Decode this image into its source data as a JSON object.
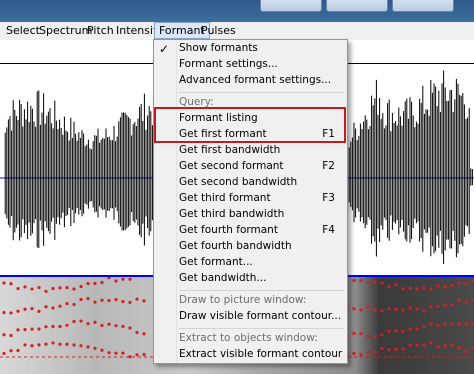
{
  "menubar": {
    "items": [
      "Select",
      "Spectrum",
      "Pitch",
      "Intensity",
      "Formant",
      "Pulses"
    ]
  },
  "formant_menu": {
    "show_formants": "Show formants",
    "formant_settings": "Formant settings...",
    "advanced_formant_settings": "Advanced formant settings...",
    "query_header": "Query:",
    "formant_listing": "Formant listing",
    "get_first_formant": "Get first formant",
    "get_first_formant_shortcut": "F1",
    "get_first_bandwidth": "Get first bandwidth",
    "get_second_formant": "Get second formant",
    "get_second_formant_shortcut": "F2",
    "get_second_bandwidth": "Get second bandwidth",
    "get_third_formant": "Get third formant",
    "get_third_formant_shortcut": "F3",
    "get_third_bandwidth": "Get third bandwidth",
    "get_fourth_formant": "Get fourth formant",
    "get_fourth_formant_shortcut": "F4",
    "get_fourth_bandwidth": "Get fourth bandwidth",
    "get_formant": "Get formant...",
    "get_bandwidth": "Get bandwidth...",
    "draw_header": "Draw to picture window:",
    "draw_visible_formant_contour": "Draw visible formant contour...",
    "extract_header": "Extract to objects window:",
    "extract_visible_formant_contour": "Extract visible formant contour"
  },
  "colors": {
    "highlight_box": "#c71a1a",
    "formant_dots": "#d42020",
    "waveform": "#000000"
  }
}
